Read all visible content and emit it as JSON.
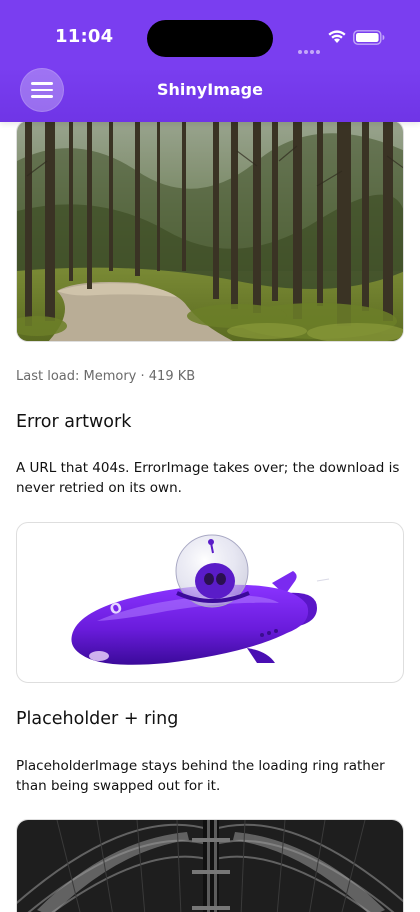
{
  "status_bar": {
    "time": "11:04"
  },
  "header": {
    "title": "ShinyImage",
    "menu_icon": "hamburger-menu-icon",
    "accent_color": "#7a3ef0"
  },
  "cards": [
    {
      "image": "forest-path-photo",
      "load_status": "Last load: Memory · 419 KB"
    },
    {
      "title": "Error artwork",
      "description": "A URL that 404s. ErrorImage takes over; the download is never retried on its own.",
      "image": "purple-spaceship-illustration"
    },
    {
      "title": "Placeholder + ring",
      "description": "PlaceholderImage stays behind the loading ring rather than being swapped out for it.",
      "image": "station-roof-photo"
    }
  ]
}
